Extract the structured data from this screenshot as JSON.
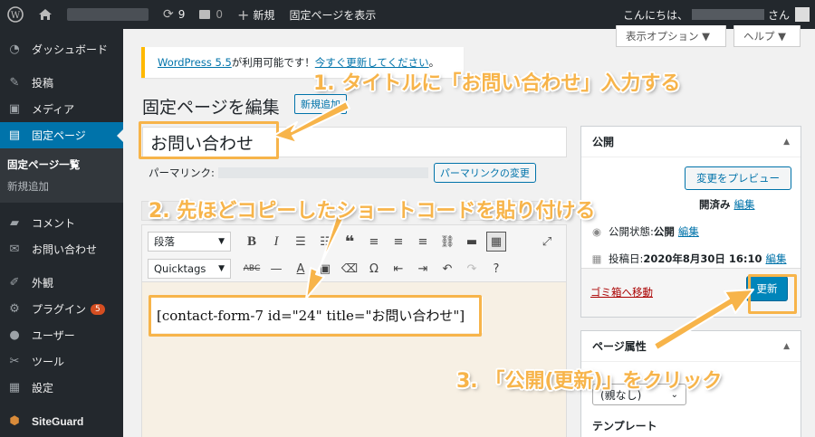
{
  "adminbar": {
    "updates": "9",
    "comments": "0",
    "new": "新規",
    "view_page": "固定ページを表示",
    "greeting": "こんにちは、",
    "san": "さん"
  },
  "sidebar": {
    "dashboard": "ダッシュボード",
    "posts": "投稿",
    "media": "メディア",
    "pages": "固定ページ",
    "pages_all": "固定ページ一覧",
    "pages_new": "新規追加",
    "comments": "コメント",
    "contact": "お問い合わせ",
    "appearance": "外観",
    "plugins": "プラグイン",
    "plugins_badge": "5",
    "users": "ユーザー",
    "tools": "ツール",
    "settings": "設定",
    "siteguard": "SiteGuard"
  },
  "screen_options": "表示オプション ▼",
  "help": "ヘルプ ▼",
  "notice": {
    "link1": "WordPress 5.5",
    "text": " が利用可能です！",
    "link2": "今すぐ更新してください",
    "end": "。"
  },
  "page_title": "固定ページを編集",
  "add_new": "新規追加",
  "title_value": "お問い合わせ",
  "permalink": {
    "label": "パーマリンク:",
    "button": "パーマリンクの変更"
  },
  "toolbar": {
    "format": "段落",
    "quicktags": "Quicktags"
  },
  "content": "[contact-form-7 id=\"24\" title=\"お問い合わせ\"]",
  "publish": {
    "title": "公開",
    "preview": "変更をプレビュー",
    "status_tail": "開済み",
    "edit": "編集",
    "visibility_label": "公開状態: ",
    "visibility_value": "公開",
    "date_label": "投稿日: ",
    "date_value": "2020年8月30日 16:10",
    "trash": "ゴミ箱へ移動",
    "update": "更新"
  },
  "page_attr": {
    "title": "ページ属性",
    "parent": "(親なし)",
    "template": "テンプレート"
  },
  "annotations": {
    "step1": "1. タイトルに「お問い合わせ」入力する",
    "step2": "2. 先ほどコピーしたショートコードを貼り付ける",
    "step3": "3. 「公開(更新)」をクリック",
    "color": "#f7b44a"
  }
}
